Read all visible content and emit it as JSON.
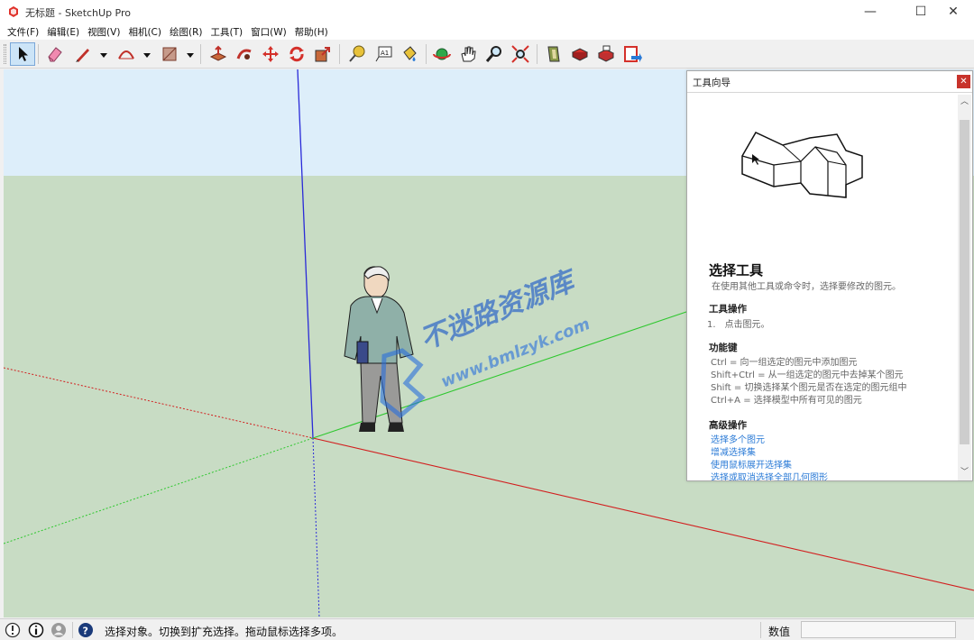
{
  "window": {
    "title": "无标题 - SketchUp Pro",
    "minimize_glyph": "—",
    "maximize_glyph": "☐",
    "close_glyph": "✕"
  },
  "menu": {
    "items": [
      {
        "label": "文件(F)"
      },
      {
        "label": "编辑(E)"
      },
      {
        "label": "视图(V)"
      },
      {
        "label": "相机(C)"
      },
      {
        "label": "绘图(R)"
      },
      {
        "label": "工具(T)"
      },
      {
        "label": "窗口(W)"
      },
      {
        "label": "帮助(H)"
      }
    ]
  },
  "toolbar": {
    "tools": [
      {
        "name": "select-tool-icon",
        "active": true
      },
      {
        "name": "eraser-tool-icon"
      },
      {
        "name": "line-tool-icon"
      },
      {
        "name": "arc-tool-icon"
      },
      {
        "name": "shape-tool-icon"
      },
      {
        "name": "push-pull-tool-icon"
      },
      {
        "name": "follow-me-tool-icon"
      },
      {
        "name": "move-tool-icon"
      },
      {
        "name": "rotate-tool-icon"
      },
      {
        "name": "scale-tool-icon"
      },
      {
        "name": "tape-measure-tool-icon"
      },
      {
        "name": "text-tool-icon"
      },
      {
        "name": "paint-bucket-tool-icon"
      },
      {
        "name": "orbit-tool-icon"
      },
      {
        "name": "pan-tool-icon"
      },
      {
        "name": "zoom-tool-icon"
      },
      {
        "name": "zoom-extents-tool-icon"
      },
      {
        "name": "3d-warehouse-icon"
      },
      {
        "name": "extension-warehouse-icon"
      },
      {
        "name": "layout-icon"
      },
      {
        "name": "send-to-layout-icon"
      }
    ],
    "text_tool_glyph": "A1"
  },
  "viewport": {
    "sky_color": "#ddeefa",
    "ground_color": "#c8dcc4",
    "axis_colors": {
      "red": "#d21e1e",
      "green": "#2ec72e",
      "blue": "#2a2ad8"
    }
  },
  "watermark": {
    "line1": "不迷路资源库",
    "line2": "www.bmlzyk.com"
  },
  "instructor": {
    "panel_title": "工具向导",
    "close_glyph": "✕",
    "tool_name": "选择工具",
    "tool_description": "在使用其他工具或命令时，选择要修改的图元。",
    "operation_title": "工具操作",
    "operation_steps": [
      "1.　点击图元。"
    ],
    "modifier_title": "功能键",
    "modifiers": [
      "Ctrl = 向一组选定的图元中添加图元",
      "Shift+Ctrl = 从一组选定的图元中去掉某个图元",
      "Shift = 切换选择某个图元是否在选定的图元组中",
      "Ctrl+A = 选择模型中所有可见的图元"
    ],
    "advanced_title": "高级操作",
    "advanced_links": [
      "选择多个图元",
      "增减选择集",
      "使用鼠标展开选择集",
      "选择或取消选择全部几何图形"
    ],
    "scroll_up_glyph": "︿",
    "scroll_down_glyph": "﹀"
  },
  "status": {
    "message": "选择对象。切换到扩充选择。拖动鼠标选择多项。",
    "measure_label": "数值",
    "measure_value": ""
  }
}
